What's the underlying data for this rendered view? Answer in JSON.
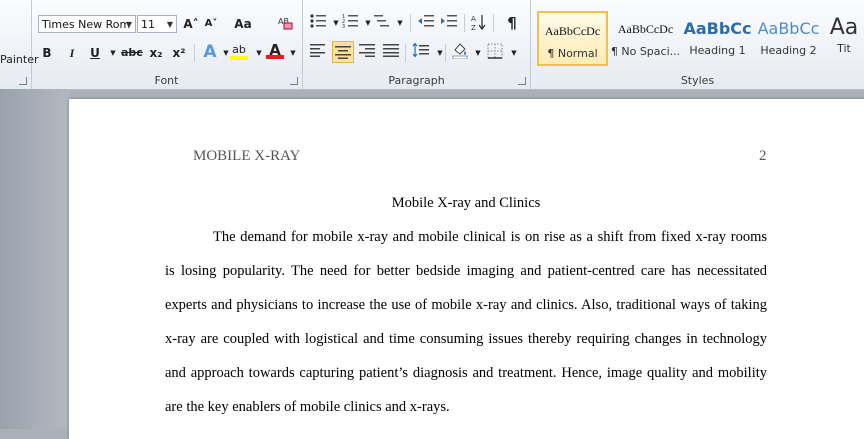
{
  "ribbon": {
    "clipboard": {
      "painter_label": "Painter"
    },
    "font": {
      "group_label": "Font",
      "font_name": "Times New Rom",
      "font_size": "11",
      "grow_icon": "A˄",
      "shrink_icon": "A˅",
      "change_case": "Aa",
      "bold": "B",
      "italic": "I",
      "underline": "U",
      "strike": "abc",
      "subscript": "x₂",
      "superscript": "x²",
      "font_color_letter": "A",
      "highlight_letters": "ab"
    },
    "paragraph": {
      "group_label": "Paragraph",
      "pilcrow": "¶"
    },
    "styles": {
      "group_label": "Styles",
      "items": [
        {
          "sample": "AaBbCcDc",
          "name": "¶ Normal"
        },
        {
          "sample": "AaBbCcDc",
          "name": "¶ No Spaci..."
        },
        {
          "sample": "AaBbCc",
          "name": "Heading 1"
        },
        {
          "sample": "AaBbCc",
          "name": "Heading 2"
        },
        {
          "sample": "Aa",
          "name": "Tit"
        }
      ]
    },
    "colors": {
      "accent": "#f0c04c",
      "font_red": "#e02020",
      "highlight_yellow": "#ffff00"
    }
  },
  "document": {
    "header_left": "MOBILE X-RAY",
    "page_number": "2",
    "title": "Mobile X-ray and Clinics",
    "lines": [
      "The demand for mobile x-ray and mobile clinical is on rise as a shift from fixed x-ray rooms",
      "is losing popularity. The need for better bedside imaging and patient-centred care has necessitated",
      "experts and physicians to increase the use of mobile x-ray and clinics. Also, traditional ways of taking",
      "x-ray are coupled with logistical and time consuming issues thereby requiring changes in technology",
      "and approach towards capturing patient’s diagnosis and treatment. Hence, image quality and mobility",
      "are the key enablers of mobile clinics and x-rays."
    ]
  }
}
